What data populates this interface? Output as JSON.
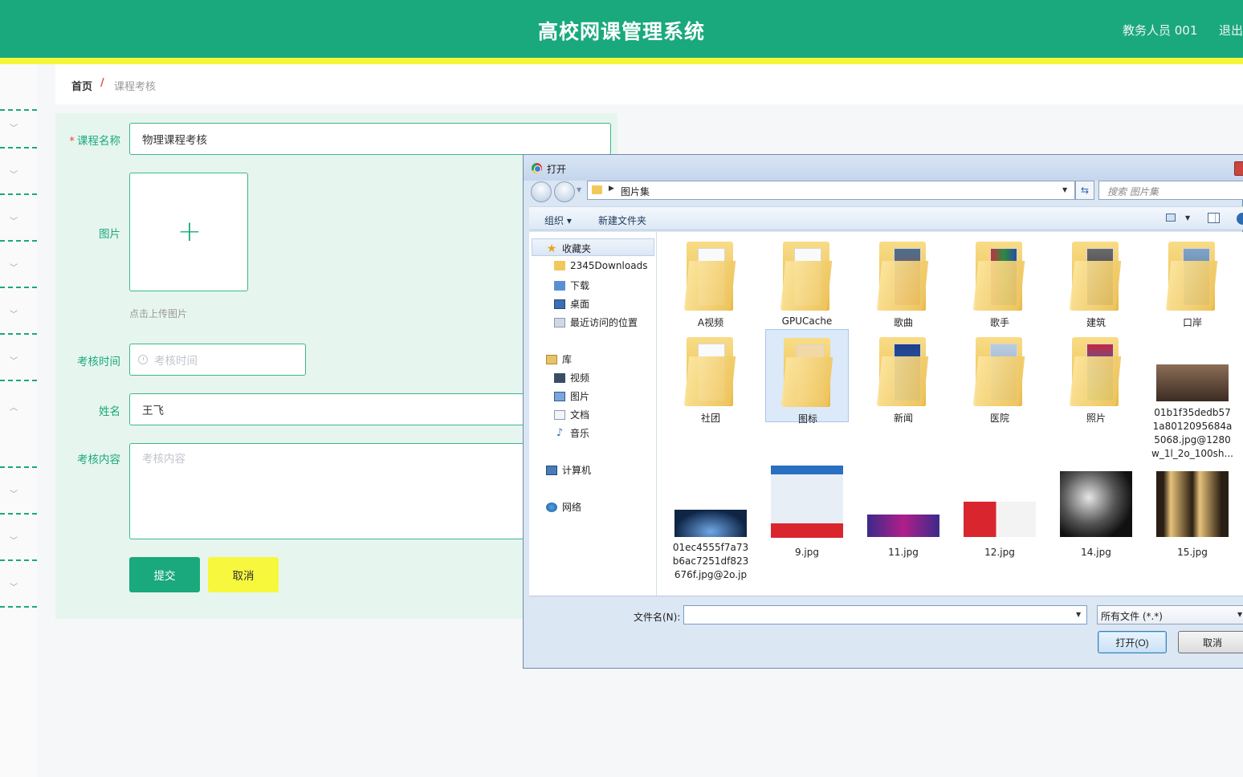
{
  "header": {
    "title": "高校网课管理系统",
    "user": "教务人员 001",
    "logout": "退出"
  },
  "breadcrumb": {
    "home": "首页",
    "separator": "/",
    "current": "课程考核"
  },
  "form": {
    "course_name": {
      "label": "课程名称",
      "required_mark": "*",
      "value": "物理课程考核"
    },
    "image": {
      "label": "图片",
      "plus": "+",
      "hint": "点击上传图片"
    },
    "exam_time": {
      "label": "考核时间",
      "placeholder": "考核时间",
      "icon": "clock-icon"
    },
    "name": {
      "label": "姓名",
      "value": "王飞"
    },
    "exam_content": {
      "label": "考核内容",
      "placeholder": "考核内容"
    },
    "submit": "提交",
    "cancel": "取消"
  },
  "dialog": {
    "title": "打开",
    "address": "图片集",
    "search_placeholder": "搜索 图片集",
    "organize": "组织 ▾",
    "new_folder": "新建文件夹",
    "nav": {
      "favorites": "收藏夹",
      "items": [
        "2345Downloads",
        "下载",
        "桌面",
        "最近访问的位置"
      ],
      "library": "库",
      "library_items": [
        "视频",
        "图片",
        "文档",
        "音乐"
      ],
      "computer": "计算机",
      "network": "网络"
    },
    "folders": [
      "A视频",
      "GPUCache",
      "歌曲",
      "歌手",
      "建筑",
      "口岸",
      "社团",
      "图标",
      "新闻",
      "医院",
      "照片"
    ],
    "file_long_1": [
      "01b1f35dedb57",
      "1a8012095684a",
      "5068.jpg@1280",
      "w_1l_2o_100sh..."
    ],
    "file_long_2": [
      "01ec4555f7a73",
      "b6ac7251df823",
      "676f.jpg@2o.jp"
    ],
    "files": [
      "9.jpg",
      "11.jpg",
      "12.jpg",
      "14.jpg",
      "15.jpg"
    ],
    "filename_label": "文件名(N):",
    "filter": "所有文件 (*.*)",
    "open": "打开(O)",
    "cancel": "取消"
  },
  "colors": {
    "primary": "#1aa97c",
    "accent_yellow": "#f5f53a"
  }
}
